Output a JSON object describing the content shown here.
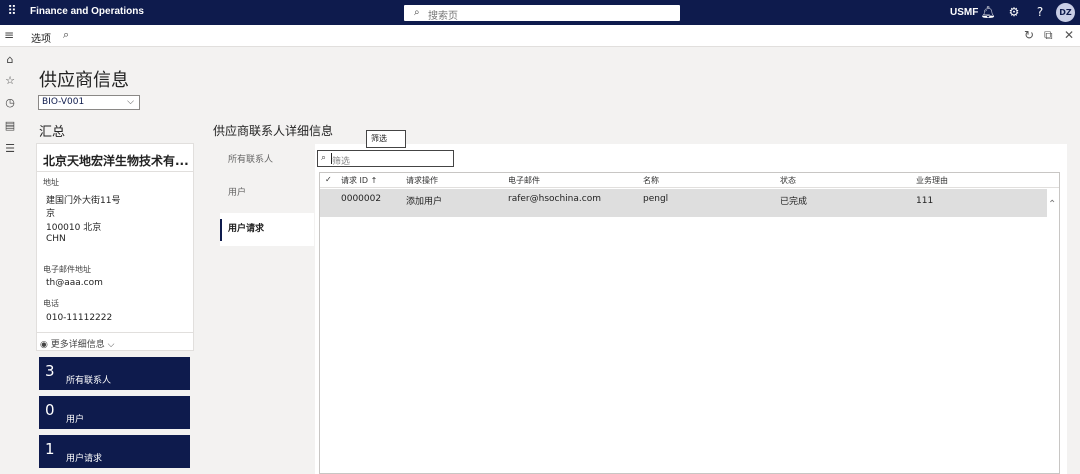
{
  "topbar": {
    "app_title": "Finance and Operations",
    "search_placeholder": "搜索页",
    "company": "USMF",
    "avatar_initials": "DZ",
    "icons": [
      "waffle-icon",
      "search-icon",
      "bell-icon",
      "gear-icon",
      "help-icon"
    ]
  },
  "actionbar": {
    "options_label": "选项",
    "icons": [
      "hamburger-icon",
      "search-icon",
      "refresh-icon",
      "open-new-window-icon",
      "close-icon"
    ]
  },
  "navrail": {
    "icons": [
      "home-icon",
      "star-icon",
      "clock-icon",
      "workspace-icon",
      "modules-list-icon"
    ]
  },
  "page": {
    "title": "供应商信息",
    "vendor_selected": "BIO-V001"
  },
  "summary": {
    "heading": "汇总",
    "vendor_name": "北京天地宏洋生物技术有...",
    "address_label": "地址",
    "address_lines": [
      "建国门外大街11号",
      "京",
      "100010 北京",
      "CHN"
    ],
    "email_label": "电子邮件地址",
    "email": "th@aaa.com",
    "phone_label": "电话",
    "phone": "010-11112222",
    "more_details": "更多详细信息"
  },
  "tiles": [
    {
      "count": "3",
      "label": "所有联系人"
    },
    {
      "count": "0",
      "label": "用户"
    },
    {
      "count": "1",
      "label": "用户请求"
    }
  ],
  "details": {
    "heading": "供应商联系人详细信息",
    "tooltip": "筛选",
    "filter_placeholder": "筛选",
    "tabs": [
      {
        "label": "所有联系人",
        "active": false
      },
      {
        "label": "用户",
        "active": false
      },
      {
        "label": "用户请求",
        "active": true
      }
    ],
    "columns": [
      "请求 ID ↑",
      "请求操作",
      "电子邮件",
      "名称",
      "状态",
      "业务理由"
    ],
    "rows": [
      [
        "0000002",
        "添加用户",
        "rafer@hsochina.com",
        "pengl",
        "已完成",
        "111"
      ]
    ]
  },
  "colors": {
    "navy": "#0e1b4d",
    "selected_row": "#dedede",
    "page_bg": "#f3f2f1"
  }
}
